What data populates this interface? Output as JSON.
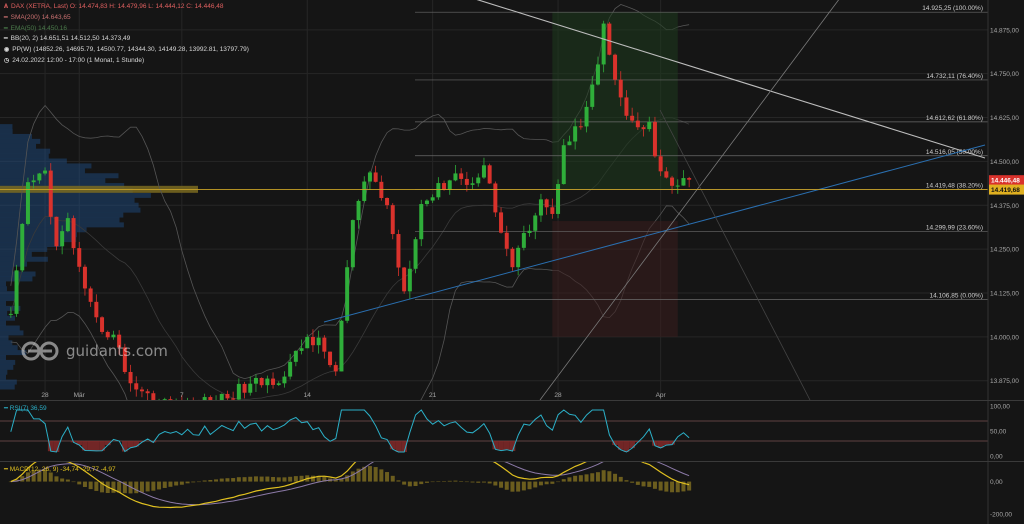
{
  "header": {
    "instrument_line": "DAX (XETRA, Last)   O: 14.474,83  H: 14.479,96  L: 14.444,12  C: 14.446,48",
    "sma200": "SMA(200)  14.643,65",
    "ema_line": "EMA(50)  14.450,16",
    "bb": "BB(20, 2)   14.651,51   14.512,50   14.373,49",
    "pp": "PP(W)   (14852.26, 14695.79, 14500.77, 14344.30, 14149.28, 13992.81, 13797.79)",
    "period": "24.02.2022 12:00 - 17:00   (1 Monat, 1 Stunde)"
  },
  "colors": {
    "background": "#151515",
    "up": "#2fae3a",
    "down": "#d9322c",
    "price_line": "#c9a227",
    "trend_line": "#2a6fb0",
    "rsi_line": "#2bb0c8",
    "macd_line": "#e0c020",
    "signal_line": "#8c7aa8",
    "volume_profile": "#1f4f8a"
  },
  "price_tags": {
    "current": "14.446,48",
    "level": "14.419,68"
  },
  "watermark": "guidants.com",
  "chart_data": [
    {
      "type": "candlestick",
      "name": "main",
      "ylim": [
        13820,
        14960
      ],
      "y_ticks": [
        "14.875,00",
        "14.750,00",
        "14.625,00",
        "14.500,00",
        "14.375,00",
        "14.250,00",
        "14.125,00",
        "14.000,00",
        "13.875,00"
      ],
      "y_tick_values": [
        14875,
        14750,
        14625,
        14500,
        14375,
        14250,
        14125,
        14000,
        13875
      ],
      "x_labels": [
        "28",
        "Mär",
        "7",
        "14",
        "21",
        "28",
        "Apr"
      ],
      "x_label_bars": [
        6,
        12,
        30,
        52,
        74,
        96,
        114
      ],
      "n_bars": 120,
      "fib_levels": [
        {
          "label": "14.925,25 (100.00%)",
          "value": 14925.25
        },
        {
          "label": "14.732,11 (76.40%)",
          "value": 14732.11
        },
        {
          "label": "14.612,62 (61.80%)",
          "value": 14612.62
        },
        {
          "label": "14.516,05 (50.00%)",
          "value": 14516.05
        },
        {
          "label": "14.419,48 (38.20%)",
          "value": 14419.48
        },
        {
          "label": "14.299,99 (23.60%)",
          "value": 14299.99
        },
        {
          "label": "14.106,85 (0.00%)",
          "value": 14106.85
        }
      ],
      "waypoints": [
        [
          0,
          14050
        ],
        [
          3,
          14430
        ],
        [
          6,
          14470
        ],
        [
          8,
          14250
        ],
        [
          10,
          14330
        ],
        [
          13,
          14120
        ],
        [
          15,
          14040
        ],
        [
          18,
          14000
        ],
        [
          21,
          13870
        ],
        [
          25,
          13820
        ],
        [
          30,
          13800
        ],
        [
          36,
          13820
        ],
        [
          42,
          13860
        ],
        [
          48,
          13890
        ],
        [
          52,
          14000
        ],
        [
          54,
          13980
        ],
        [
          57,
          13900
        ],
        [
          60,
          14330
        ],
        [
          63,
          14470
        ],
        [
          66,
          14370
        ],
        [
          69,
          14130
        ],
        [
          72,
          14380
        ],
        [
          75,
          14420
        ],
        [
          78,
          14470
        ],
        [
          80,
          14430
        ],
        [
          83,
          14490
        ],
        [
          86,
          14300
        ],
        [
          88,
          14200
        ],
        [
          90,
          14280
        ],
        [
          93,
          14400
        ],
        [
          95,
          14340
        ],
        [
          97,
          14560
        ],
        [
          100,
          14600
        ],
        [
          103,
          14760
        ],
        [
          104,
          14890
        ],
        [
          106,
          14720
        ],
        [
          108,
          14640
        ],
        [
          110,
          14580
        ],
        [
          112,
          14600
        ],
        [
          114,
          14460
        ],
        [
          116,
          14430
        ],
        [
          119,
          14446
        ]
      ]
    },
    {
      "type": "line",
      "name": "RSI",
      "legend": "RSI(7)  36,59",
      "ylim": [
        -10,
        110
      ],
      "y_ticks": [
        "100,00",
        "50,00",
        "0,00"
      ],
      "y_tick_values": [
        100,
        50,
        0
      ],
      "last_value": 36.59
    },
    {
      "type": "line",
      "name": "MACD",
      "legend": "MACD(12, 26, 9)   -34,74   -29,77   -4,97",
      "ylim": [
        -260,
        120
      ],
      "y_ticks": [
        "0,00",
        "-200,00"
      ],
      "y_tick_values": [
        0,
        -200
      ],
      "values": [
        -34.74,
        -29.77,
        -4.97
      ]
    }
  ]
}
